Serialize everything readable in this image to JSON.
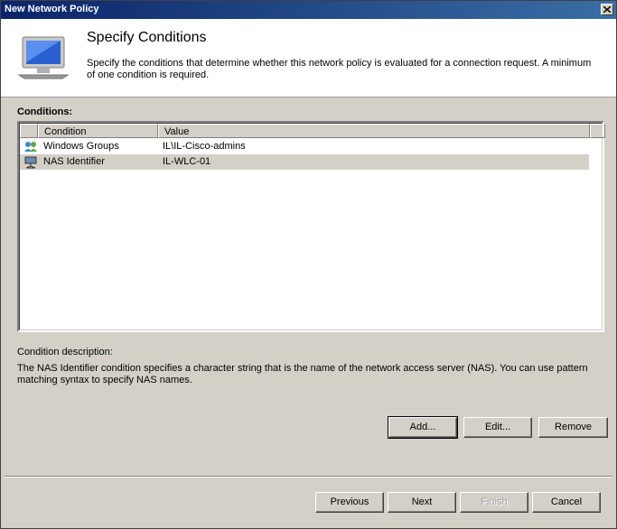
{
  "window": {
    "title": "New Network Policy"
  },
  "header": {
    "heading": "Specify Conditions",
    "description": "Specify the conditions that determine whether this network policy is evaluated for a connection request. A minimum of one condition is required."
  },
  "conditions": {
    "label": "Conditions:",
    "columns": [
      "Condition",
      "Value"
    ],
    "rows": [
      {
        "condition": "Windows Groups",
        "value": "IL\\IL-Cisco-admins",
        "icon": "group-icon",
        "selected": false
      },
      {
        "condition": "NAS Identifier",
        "value": "IL-WLC-01",
        "icon": "network-icon",
        "selected": true
      }
    ]
  },
  "description": {
    "label": "Condition description:",
    "text": "The NAS Identifier condition specifies a character string that is the name of the network access server (NAS). You can use pattern matching syntax to specify NAS names."
  },
  "actions": {
    "add": "Add...",
    "edit": "Edit...",
    "remove": "Remove"
  },
  "nav": {
    "previous": "Previous",
    "next": "Next",
    "finish": "Finish",
    "cancel": "Cancel"
  }
}
